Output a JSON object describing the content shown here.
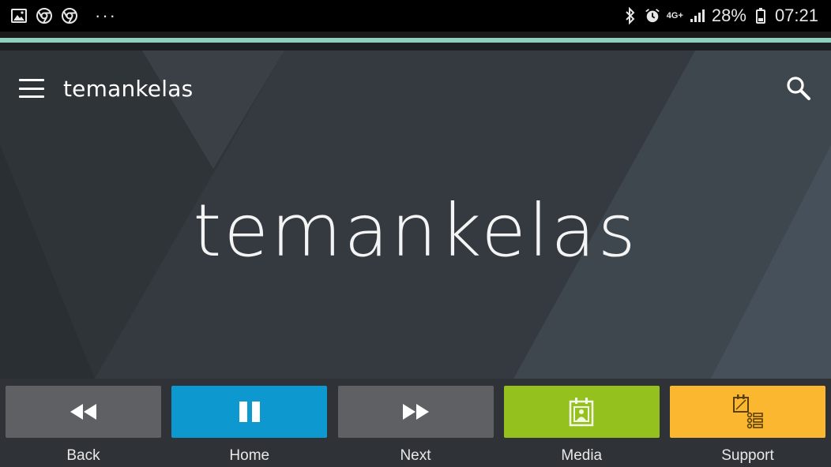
{
  "status_bar": {
    "left_icons": [
      "gallery-icon",
      "chrome-icon",
      "chrome-icon"
    ],
    "overflow": "···",
    "network": "4G+",
    "battery_percent": "28%",
    "time": "07:21"
  },
  "app_bar": {
    "title": "temankelas"
  },
  "hero": {
    "title": "temankelas"
  },
  "bottom_nav": [
    {
      "label": "Back",
      "icon": "rewind-icon",
      "color": "#5f6063"
    },
    {
      "label": "Home",
      "icon": "pause-icon",
      "color": "#0e98d0"
    },
    {
      "label": "Next",
      "icon": "fast-forward-icon",
      "color": "#5f6063"
    },
    {
      "label": "Media",
      "icon": "media-calendar-icon",
      "color": "#95c11f"
    },
    {
      "label": "Support",
      "icon": "support-list-icon",
      "color": "#fbb730"
    }
  ],
  "colors": {
    "accent_line": "#8fd0c0",
    "background": "#353b41"
  }
}
